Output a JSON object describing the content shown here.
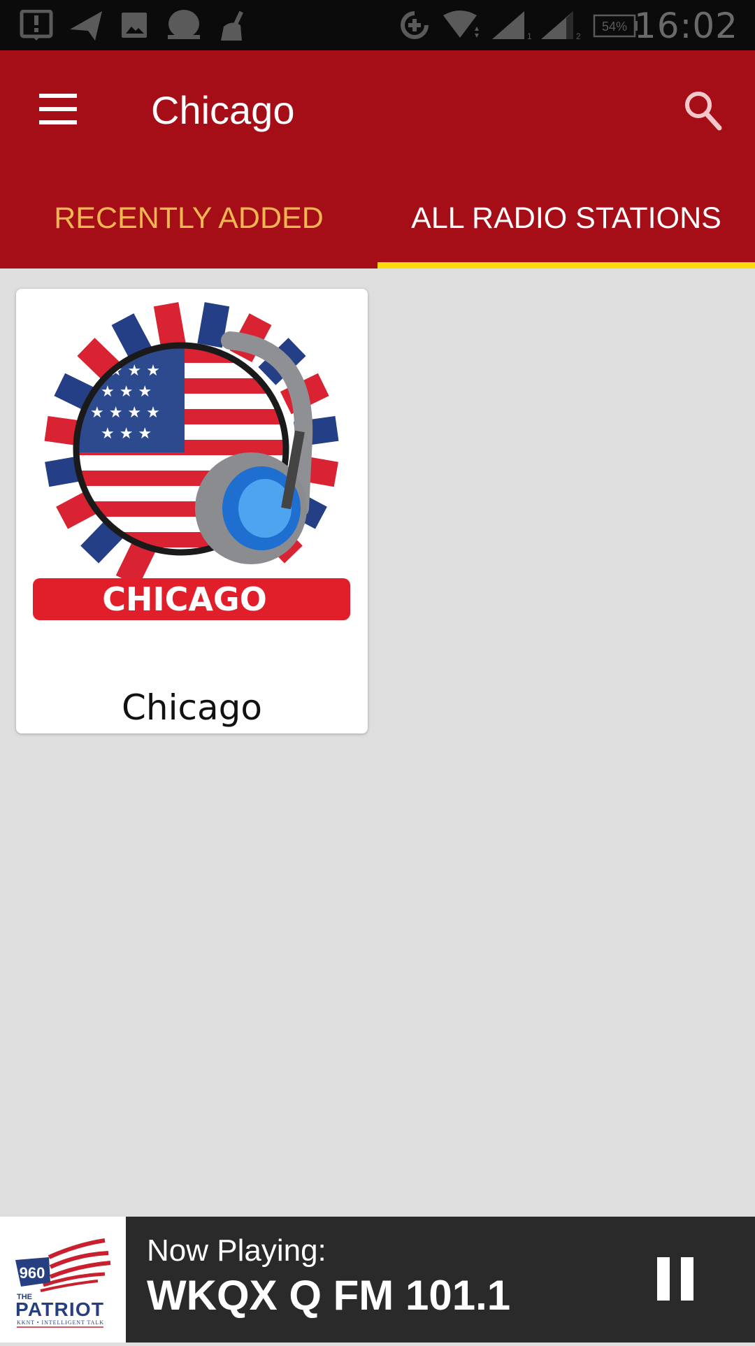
{
  "status_bar": {
    "left_icons": [
      "alert-download-icon",
      "navigation-icon",
      "image-icon",
      "chat-bubble-icon",
      "cleaner-broom-icon"
    ],
    "right_icons": [
      "data-saver-icon",
      "wifi-icon",
      "signal-sim1-icon",
      "signal-sim2-icon",
      "battery-icon"
    ],
    "sim1_label": "1",
    "sim2_label": "2",
    "battery": "54%",
    "time": "16:02"
  },
  "app_bar": {
    "title": "Chicago",
    "menu_icon": "hamburger-menu-icon",
    "search_icon": "search-icon",
    "background_color": "#a50e17"
  },
  "tabs": [
    {
      "label": "RECENTLY ADDED",
      "active": false,
      "color": "#efb652"
    },
    {
      "label": "ALL RADIO STATIONS",
      "active": true,
      "color": "#ffffff"
    }
  ],
  "tab_indicator_color": "#fcd80c",
  "stations_grid": [
    {
      "name": "Chicago",
      "image_label": "CHICAGO",
      "image": "us-flag-headphones-logo"
    }
  ],
  "now_playing": {
    "label": "Now Playing:",
    "station": "WKQX Q FM 101.1",
    "logo": {
      "number": "960",
      "the": "THE",
      "name": "PATRIOT",
      "tagline": "KKNT • INTELLIGENT TALK"
    },
    "control": "pause-icon"
  }
}
